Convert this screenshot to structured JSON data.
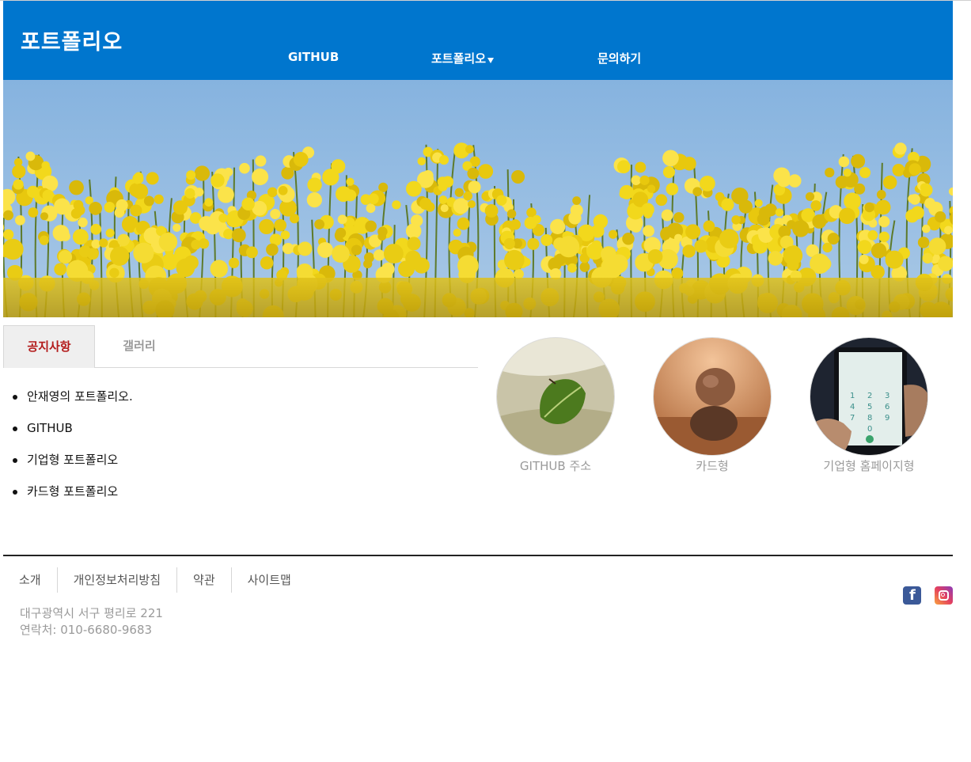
{
  "header": {
    "logo": "포트폴리오",
    "nav": [
      "GITHUB",
      "포트폴리오",
      "문의하기"
    ]
  },
  "tabs": [
    "공지사항",
    "갤러리"
  ],
  "notices": [
    "안재영의 포트폴리오.",
    "GITHUB",
    "기업형 포트폴리오",
    "카드형 포트폴리오"
  ],
  "gallery": [
    {
      "caption": "GITHUB 주소"
    },
    {
      "caption": "카드형"
    },
    {
      "caption": "기업형 홈페이지형"
    }
  ],
  "footer": {
    "menu": [
      "소개",
      "개인정보처리방침",
      "약관",
      "사이트맵"
    ],
    "address": "대구광역시 서구 평리로 221",
    "contact": "연락처: 010-6680-9683"
  },
  "colors": {
    "header_bg": "#0076ce",
    "active_tab": "#b31b1b",
    "facebook": "#3b5998"
  }
}
